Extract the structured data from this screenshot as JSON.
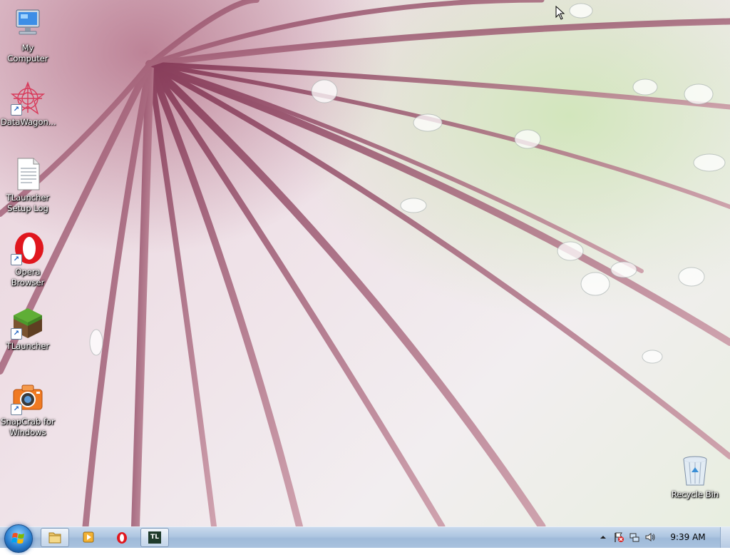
{
  "desktop_icons": [
    {
      "name": "my-computer",
      "label": "My Computer",
      "icon": "computer-icon",
      "shortcut": false
    },
    {
      "name": "datawagon",
      "label": "DataWagon...",
      "icon": "datawagon-icon",
      "shortcut": true
    },
    {
      "name": "tlauncher-setup-log",
      "label": "TLauncher Setup Log",
      "icon": "text-document-icon",
      "shortcut": false
    },
    {
      "name": "opera-browser",
      "label": "Opera Browser",
      "icon": "opera-icon",
      "shortcut": true
    },
    {
      "name": "tlauncher",
      "label": "TLauncher",
      "icon": "minecraft-block-icon",
      "shortcut": true
    },
    {
      "name": "snapcrab",
      "label": "SnapCrab for Windows",
      "icon": "camera-icon",
      "shortcut": true
    },
    {
      "name": "recycle-bin",
      "label": "Recycle Bin",
      "icon": "recycle-bin-icon",
      "shortcut": false
    }
  ],
  "taskbar": {
    "start": {
      "icon": "windows-logo-icon"
    },
    "pinned": [
      {
        "name": "explorer",
        "icon": "folder-icon",
        "active": true
      },
      {
        "name": "media-player",
        "icon": "media-player-icon",
        "active": false
      },
      {
        "name": "opera",
        "icon": "opera-icon",
        "active": false
      },
      {
        "name": "tlauncher",
        "icon": "tlauncher-icon",
        "label": "TL",
        "active": true
      }
    ],
    "tray": {
      "icons": [
        "show-hidden-icons-chevron",
        "action-center-flag-icon",
        "network-icon",
        "volume-icon"
      ],
      "clock": "9:39 AM"
    }
  },
  "colors": {
    "taskbar": "#a9c2de",
    "opera_red": "#e0171e",
    "label_text": "#ffffff"
  }
}
